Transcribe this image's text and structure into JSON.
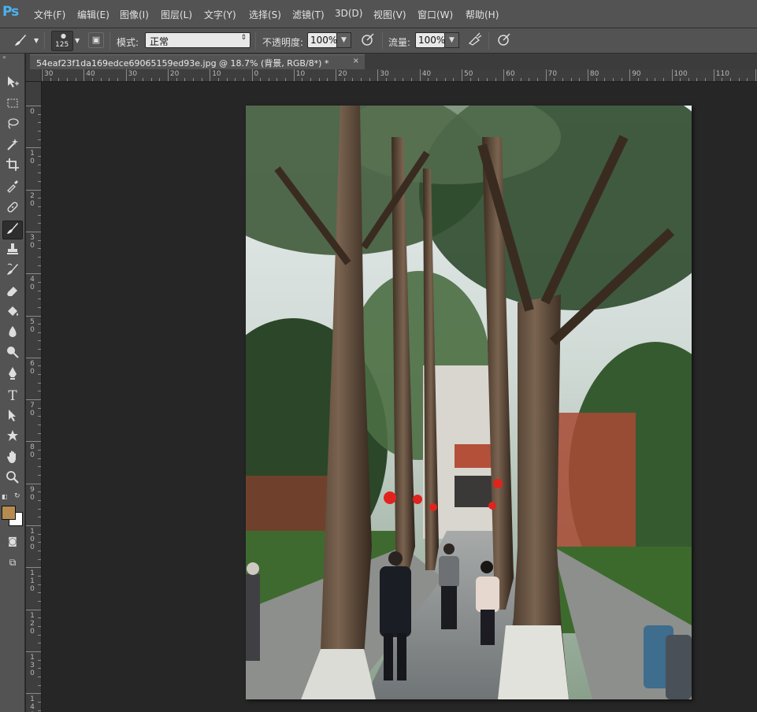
{
  "app": {
    "logo": "Ps",
    "brand_color": "#49b3f2"
  },
  "menu": {
    "items": [
      "文件(F)",
      "编辑(E)",
      "图像(I)",
      "图层(L)",
      "文字(Y)",
      "选择(S)",
      "滤镜(T)",
      "3D(D)",
      "视图(V)",
      "窗口(W)",
      "帮助(H)"
    ]
  },
  "options": {
    "brush_size": "125",
    "mode_label": "模式:",
    "mode_value": "正常",
    "opacity_label": "不透明度:",
    "opacity_value": "100%",
    "flow_label": "流量:",
    "flow_value": "100%"
  },
  "document": {
    "tab_title": "54eaf23f1da169edce69065159ed93e.jpg @ 18.7% (背景, RGB/8*) *",
    "close": "×"
  },
  "rulers": {
    "h_labels": [
      "30",
      "40",
      "30",
      "20",
      "10",
      "0",
      "10",
      "20",
      "30",
      "40",
      "50",
      "60",
      "70",
      "80",
      "90",
      "100",
      "110",
      "12"
    ],
    "v_labels": [
      "0",
      "10",
      "20",
      "30",
      "40",
      "50",
      "60",
      "70",
      "80",
      "90",
      "100",
      "110",
      "120",
      "130",
      "140"
    ]
  },
  "colors": {
    "foreground": "#b58b50",
    "background": "#ffffff"
  },
  "icons": [
    "move-icon",
    "marquee-icon",
    "lasso-icon",
    "magic-wand-icon",
    "crop-icon",
    "eyedropper-icon",
    "healing-brush-icon",
    "brush-icon",
    "stamp-icon",
    "history-brush-icon",
    "eraser-icon",
    "paint-bucket-icon",
    "blur-icon",
    "dodge-icon",
    "pen-icon",
    "type-icon",
    "path-selection-icon",
    "shape-icon",
    "hand-icon",
    "zoom-icon"
  ]
}
